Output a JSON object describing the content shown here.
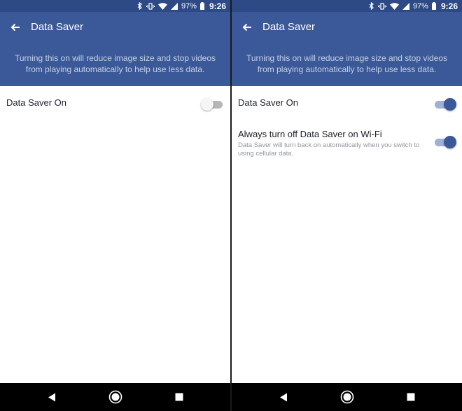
{
  "status_bar": {
    "battery": "97%",
    "time": "9:26",
    "icons": [
      "bluetooth-icon",
      "vibrate-icon",
      "wifi-icon",
      "signal-icon",
      "battery-icon"
    ]
  },
  "app_bar": {
    "back_icon": "back-arrow-icon",
    "title": "Data Saver"
  },
  "banner": {
    "text": "Turning this on will reduce image size and stop videos from playing automatically to help use less data."
  },
  "screens": [
    {
      "settings": [
        {
          "label": "Data Saver On",
          "enabled": false
        }
      ]
    },
    {
      "settings": [
        {
          "label": "Data Saver On",
          "enabled": true
        },
        {
          "label": "Always turn off Data Saver on Wi-Fi",
          "description": "Data Saver will turn back on automatically when you switch to using cellular data.",
          "enabled": true
        }
      ]
    }
  ],
  "nav_bar": {
    "icons": [
      "back-triangle-icon",
      "home-circle-icon",
      "recents-square-icon"
    ]
  },
  "colors": {
    "status_bar": "#2d4a86",
    "app_bar": "#3b5998",
    "banner_text": "#c4cfe6",
    "toggle_on_knob": "#3b5998",
    "toggle_on_track": "#9fb0d6",
    "toggle_off_track": "#b6b6b6"
  }
}
